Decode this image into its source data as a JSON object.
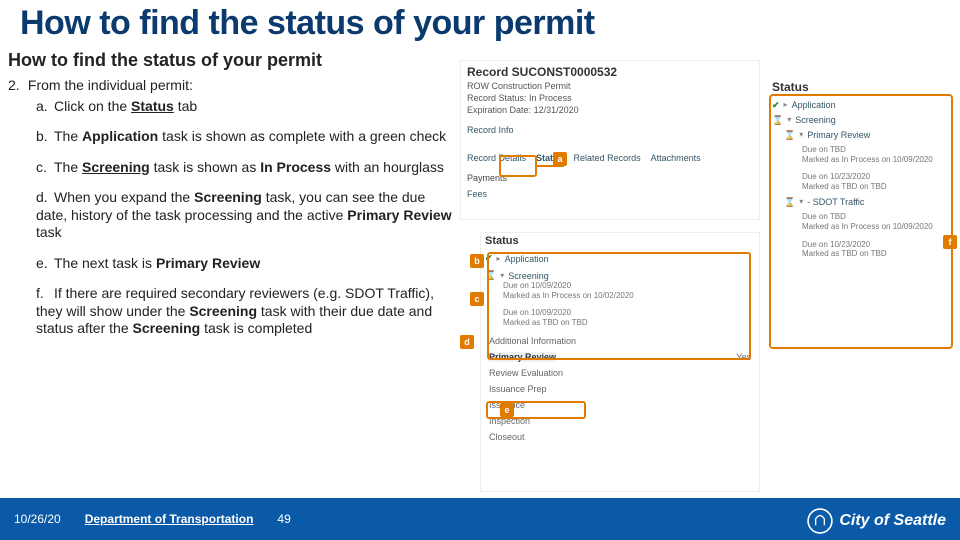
{
  "title": "How to find the status of your permit",
  "subtitle": "How to find the status of your permit",
  "step_number": "2.",
  "step_text": "From the individual permit:",
  "items": {
    "a": {
      "l": "a.",
      "pre": "Click on the ",
      "b": "Status",
      "post": " tab"
    },
    "b": {
      "l": "b.",
      "pre": "The ",
      "b": "Application",
      "post1": " task is shown as complete with a green check"
    },
    "c": {
      "l": "c.",
      "pre": "The ",
      "b": "Screening",
      "post1": " task is shown as ",
      "b2": "In Process",
      "post2": " with an hourglass"
    },
    "d": {
      "l": "d.",
      "pre": "When you expand the ",
      "b": "Screening",
      "post1": " task, you can see the due date, history of the task processing and the active ",
      "b2": "Primary Review",
      "post2": " task"
    },
    "e": {
      "l": "e.",
      "pre": "The next task is ",
      "b": "Primary Review",
      "post": ""
    },
    "f": {
      "l": "f.",
      "text": "If there are required secondary reviewers (e.g. SDOT Traffic), they will  show under the ",
      "b": "Screening",
      "post": " task with their due date and status after the ",
      "b2": "Screening",
      "post2": " task is completed"
    }
  },
  "record": {
    "title": "Record SUCONST0000532",
    "type": "ROW Construction Permit",
    "status_label": "Record Status:",
    "status_value": "In Process",
    "expire_label": "Expiration Date:",
    "expire_value": "12/31/2020",
    "section": "Record Info",
    "tabs": {
      "details": "Record Details",
      "status": "Status",
      "related": "Related Records",
      "attachments": "Attachments"
    },
    "payments": "Payments",
    "fees": "Fees"
  },
  "status_panel": {
    "header": "Status",
    "application": "Application",
    "screening": "Screening",
    "due1": "Due on 10/09/2020",
    "marked1": "Marked as In Process on 10/02/2020",
    "due2": "Due on 10/09/2020",
    "marked2": "Marked as TBD on TBD",
    "lower": [
      "Additional Information",
      "Primary Review",
      "Review Evaluation",
      "Issuance Prep",
      "Issuance",
      "Inspection",
      "Closeout"
    ],
    "yes": "Yes"
  },
  "right": {
    "header": "Status",
    "app": "Application",
    "screening": "Screening",
    "primary": "Primary Review",
    "pr_due": "Due on TBD",
    "pr_marked": "Marked as In Process on 10/09/2020",
    "due1": "Due on 10/23/2020",
    "marked1": "Marked as TBD on TBD",
    "sdot": "- SDOT Traffic",
    "sdot_due": "Due on TBD",
    "sdot_marked": "Marked as In Process on 10/09/2020",
    "due2": "Due on 10/23/2020",
    "marked2": "Marked as TBD on TBD"
  },
  "callouts": {
    "a": "a",
    "b": "b",
    "c": "c",
    "d": "d",
    "e": "e",
    "f": "f"
  },
  "footer": {
    "date": "10/26/20",
    "dept": "Department of Transportation",
    "page": "49",
    "brand": "City of Seattle"
  }
}
